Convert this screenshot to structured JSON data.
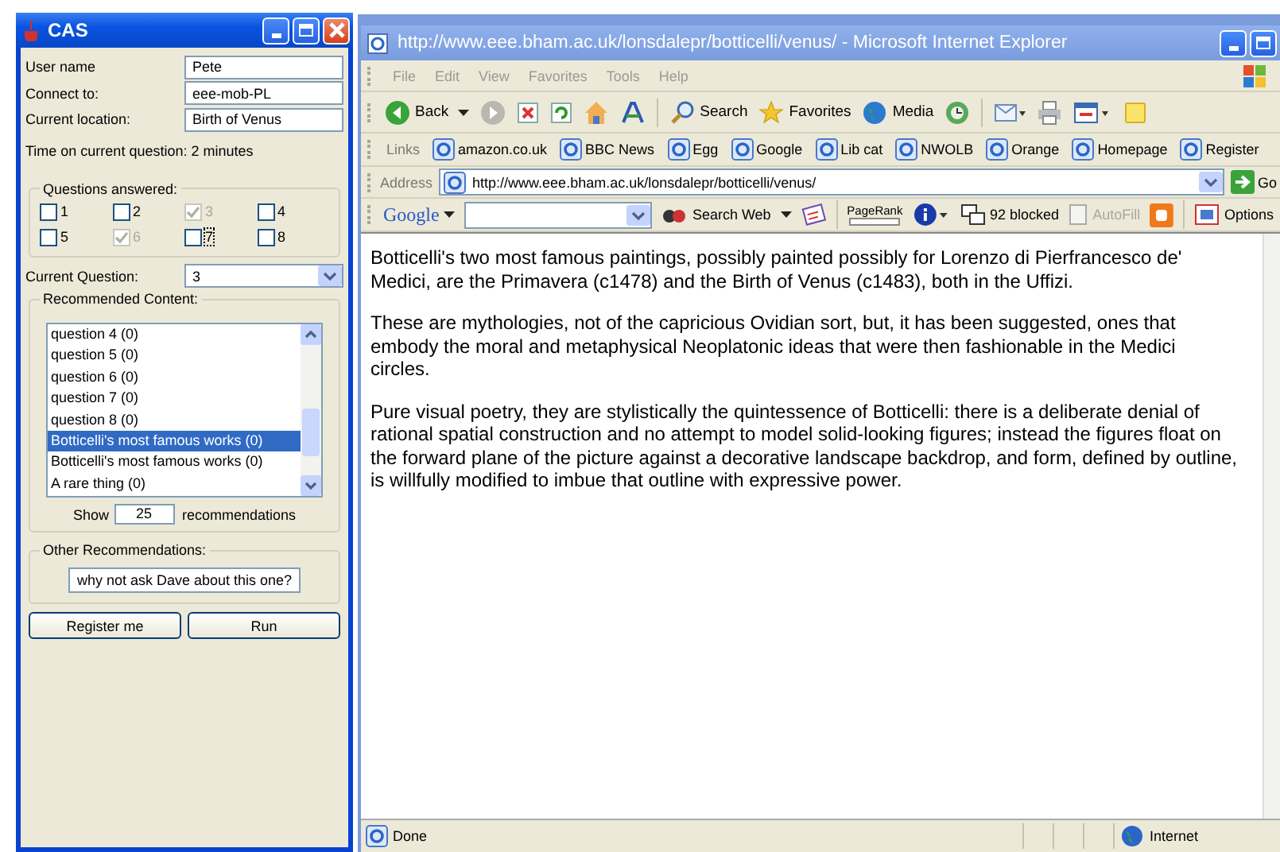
{
  "cas_window": {
    "title": "CAS",
    "fields": [
      {
        "label": "User name",
        "value": "Pete"
      },
      {
        "label": "Connect to:",
        "value": "eee-mob-PL"
      },
      {
        "label": "Current location:",
        "value": "Birth of Venus"
      }
    ],
    "time_text": "Time on current question: 2 minutes",
    "questions_answered": {
      "title": "Questions answered:",
      "items": [
        {
          "label": "1",
          "checked": false,
          "disabled": false,
          "focused": false
        },
        {
          "label": "2",
          "checked": false,
          "disabled": false,
          "focused": false
        },
        {
          "label": "3",
          "checked": true,
          "disabled": true,
          "focused": false
        },
        {
          "label": "4",
          "checked": false,
          "disabled": false,
          "focused": false
        },
        {
          "label": "5",
          "checked": false,
          "disabled": false,
          "focused": false
        },
        {
          "label": "6",
          "checked": true,
          "disabled": true,
          "focused": false
        },
        {
          "label": "7",
          "checked": false,
          "disabled": false,
          "focused": true
        },
        {
          "label": "8",
          "checked": false,
          "disabled": false,
          "focused": false
        }
      ]
    },
    "current_question": {
      "label": "Current Question:",
      "value": "3"
    },
    "recommended": {
      "title": "Recommended Content:",
      "items": [
        {
          "label": "question 4 (0)",
          "selected": false
        },
        {
          "label": "question 5 (0)",
          "selected": false
        },
        {
          "label": "question 6 (0)",
          "selected": false
        },
        {
          "label": "question 7 (0)",
          "selected": false
        },
        {
          "label": "question 8 (0)",
          "selected": false
        },
        {
          "label": "Botticelli's most famous works (0)",
          "selected": true
        },
        {
          "label": "Botticelli's most famous works (0)",
          "selected": false
        },
        {
          "label": "A rare thing (0)",
          "selected": false
        }
      ],
      "show_label": "Show",
      "show_value": "25",
      "show_suffix": "recommendations"
    },
    "other": {
      "title": "Other Recommendations:",
      "button": "why not ask Dave about this one?"
    },
    "buttons": [
      "Register me",
      "Run"
    ]
  },
  "browser": {
    "title": "http://www.eee.bham.ac.uk/lonsdalepr/botticelli/venus/ - Microsoft Internet Explorer",
    "menu": [
      "File",
      "Edit",
      "View",
      "Favorites",
      "Tools",
      "Help"
    ],
    "toolbar": {
      "back": "Back",
      "search": "Search",
      "favorites": "Favorites",
      "media": "Media"
    },
    "links_label": "Links",
    "links": [
      "amazon.co.uk",
      "BBC News",
      "Egg",
      "Google",
      "Lib cat",
      "NWOLB",
      "Orange",
      "Homepage",
      "Register"
    ],
    "address_label": "Address",
    "address": "http://www.eee.bham.ac.uk/lonsdalepr/botticelli/venus/",
    "go": "Go",
    "google_bar": {
      "logo": "Google",
      "search_web": "Search Web",
      "pagerank": "PageRank",
      "blocked": "92 blocked",
      "autofill": "AutoFill",
      "options": "Options"
    },
    "paragraphs": [
      "Botticelli's two most famous paintings, possibly painted possibly for Lorenzo di Pierfrancesco de' Medici, are the Primavera (c1478) and the Birth of Venus (c1483), both in the Uffizi.",
      "These are mythologies, not of the capricious Ovidian sort, but, it has been suggested, ones that embody the moral and metaphysical Neoplatonic ideas that were then fashionable in the Medici circles.",
      "Pure visual poetry, they are stylistically the quintessence of Botticelli: there is a deliberate denial of rational spatial construction and no attempt to model solid-looking figures; instead the figures float on the forward plane of the picture against a decorative landscape backdrop, and form, defined by outline, is willfully modified to imbue that outline with expressive power."
    ],
    "status": {
      "text": "Done",
      "zone": "Internet"
    }
  }
}
